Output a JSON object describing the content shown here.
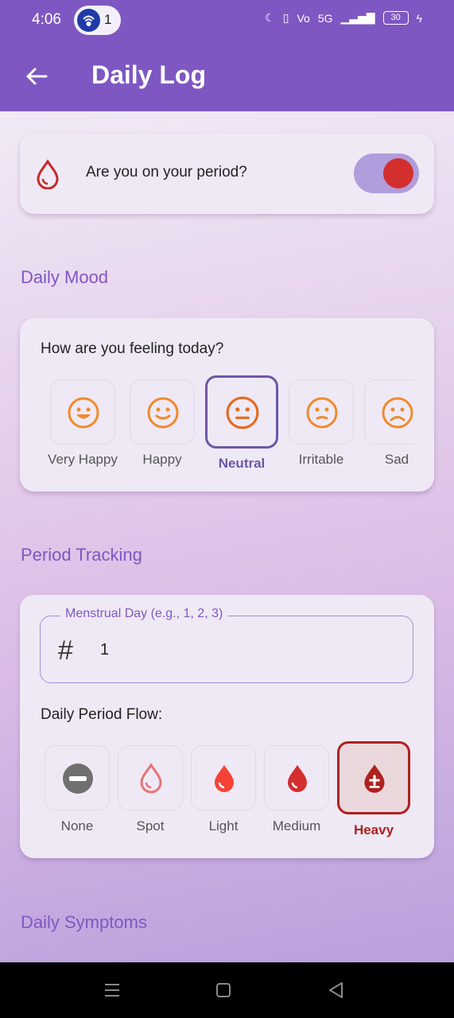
{
  "status_bar": {
    "time": "4:06",
    "notification_count": "1",
    "network": "5G",
    "battery": "30"
  },
  "app_bar": {
    "title": "Daily Log",
    "back_icon": "arrow-left-icon"
  },
  "period_card": {
    "question": "Are you on your period?",
    "toggle_on": true,
    "icon": "blood-drop-icon"
  },
  "mood_section": {
    "title": "Daily Mood",
    "question": "How are you feeling today?",
    "options": [
      {
        "label": "Very Happy",
        "icon": "very-happy-face-icon",
        "selected": false
      },
      {
        "label": "Happy",
        "icon": "happy-face-icon",
        "selected": false
      },
      {
        "label": "Neutral",
        "icon": "neutral-face-icon",
        "selected": true
      },
      {
        "label": "Irritable",
        "icon": "irritable-face-icon",
        "selected": false
      },
      {
        "label": "Sad",
        "icon": "sad-face-icon",
        "selected": false
      }
    ]
  },
  "period_tracking": {
    "title": "Period Tracking",
    "menstrual_day_label": "Menstrual Day (e.g., 1, 2, 3)",
    "menstrual_day_value": "1",
    "flow_title": "Daily Period Flow:",
    "flow_options": [
      {
        "label": "None",
        "icon": "minus-circle-icon",
        "selected": false
      },
      {
        "label": "Spot",
        "icon": "drop-outline-icon",
        "selected": false
      },
      {
        "label": "Light",
        "icon": "drop-light-icon",
        "selected": false
      },
      {
        "label": "Medium",
        "icon": "drop-medium-icon",
        "selected": false
      },
      {
        "label": "Heavy",
        "icon": "drop-heavy-icon",
        "selected": true
      }
    ]
  },
  "symptoms_section": {
    "title": "Daily Symptoms"
  },
  "colors": {
    "primary": "#7e57c2",
    "heavy": "#b0201e",
    "toggle_knob": "#d32f2f",
    "mood_orange": "#ef8a2d"
  }
}
